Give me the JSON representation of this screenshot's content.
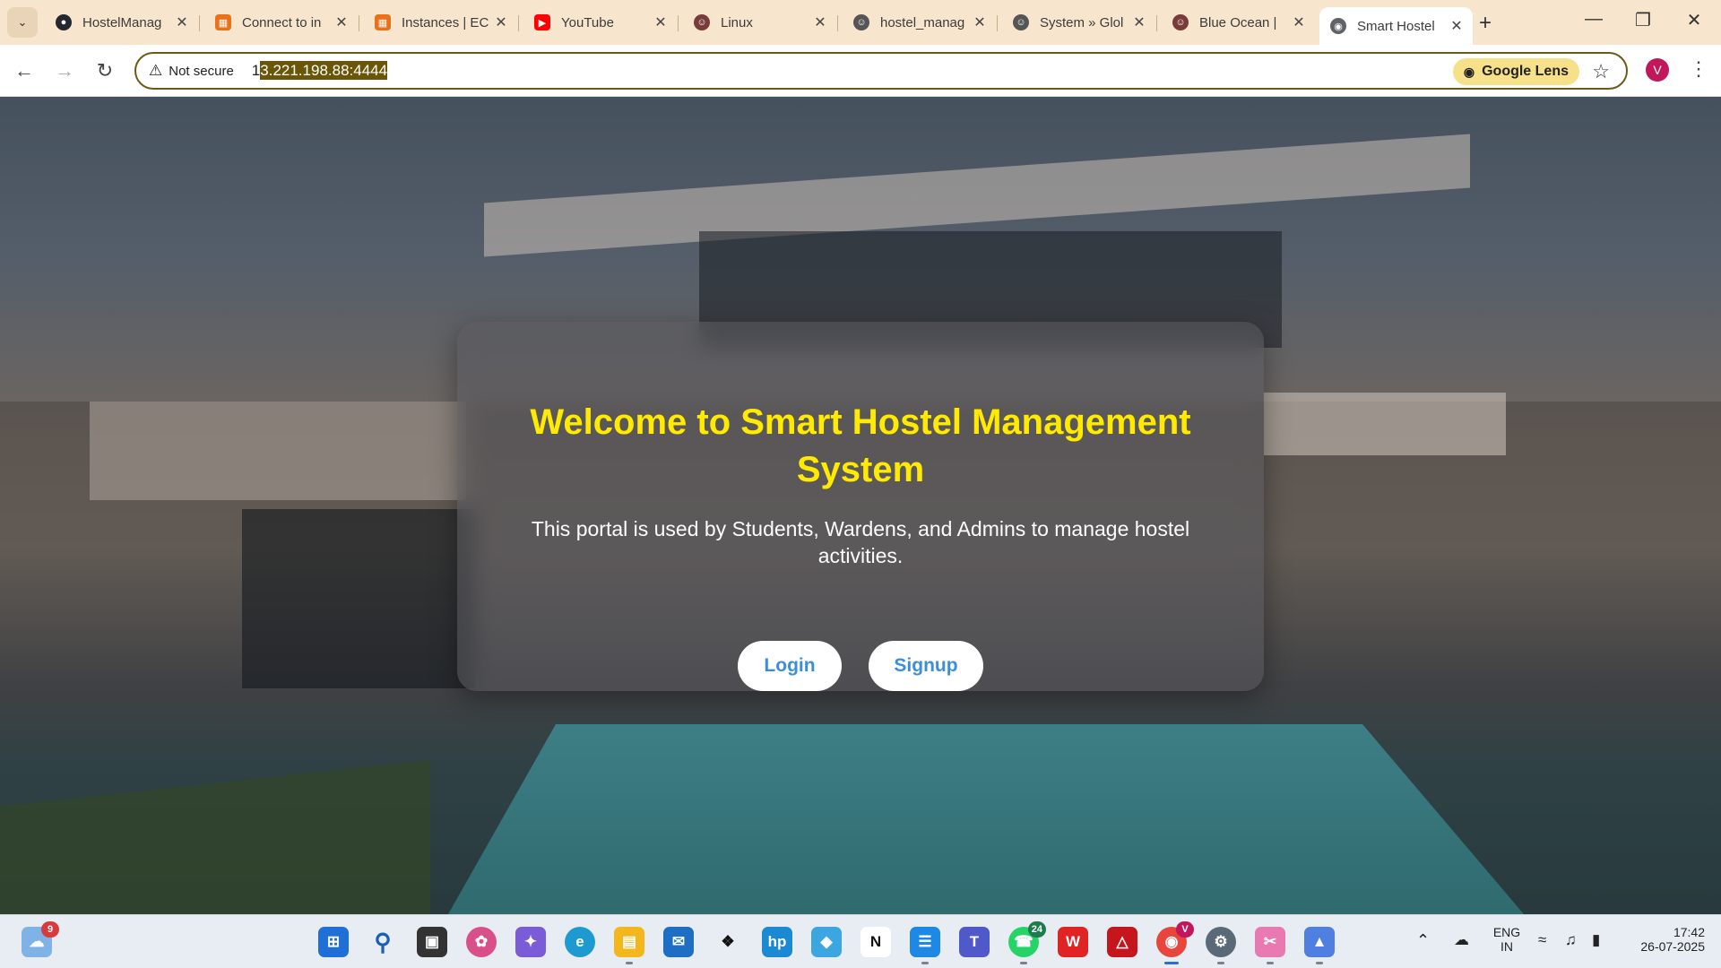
{
  "browser": {
    "tabs": [
      {
        "title": "HostelManag",
        "favicon": "github-icon",
        "color": "#24292f"
      },
      {
        "title": "Connect to in",
        "favicon": "aws-icon",
        "color": "#e8711a"
      },
      {
        "title": "Instances | EC",
        "favicon": "aws-icon",
        "color": "#e8711a"
      },
      {
        "title": "YouTube",
        "favicon": "youtube-icon",
        "color": "#ff0000"
      },
      {
        "title": "Linux",
        "favicon": "jenkins-icon",
        "color": "#7a3b3b"
      },
      {
        "title": "hostel_manag",
        "favicon": "jenkins-icon",
        "color": "#555555"
      },
      {
        "title": "System » Glol",
        "favicon": "jenkins-icon",
        "color": "#555555"
      },
      {
        "title": "Blue Ocean |",
        "favicon": "jenkins-icon",
        "color": "#7a3b3b"
      },
      {
        "title": "Smart Hostel",
        "favicon": "globe-icon",
        "color": "#5f6368",
        "active": true
      }
    ],
    "security_label": "Not secure",
    "url_prefix": "1",
    "url_selected": "3.221.198.88:4444",
    "lens_label": "Google Lens",
    "profile_initial": "V"
  },
  "page": {
    "heading": "Welcome to Smart Hostel Management System",
    "description": "This portal is used by Students, Wardens, and Admins to manage hostel activities.",
    "login_label": "Login",
    "signup_label": "Signup"
  },
  "taskbar": {
    "weather_badge": "9",
    "whatsapp_badge": "24",
    "chrome_badge": "V",
    "language": "ENG",
    "region": "IN",
    "time": "17:42",
    "date": "26-07-2025"
  },
  "colors": {
    "heading": "#ffea00",
    "button_text": "#3b8ed8",
    "tabstrip": "#f7e6cd"
  }
}
